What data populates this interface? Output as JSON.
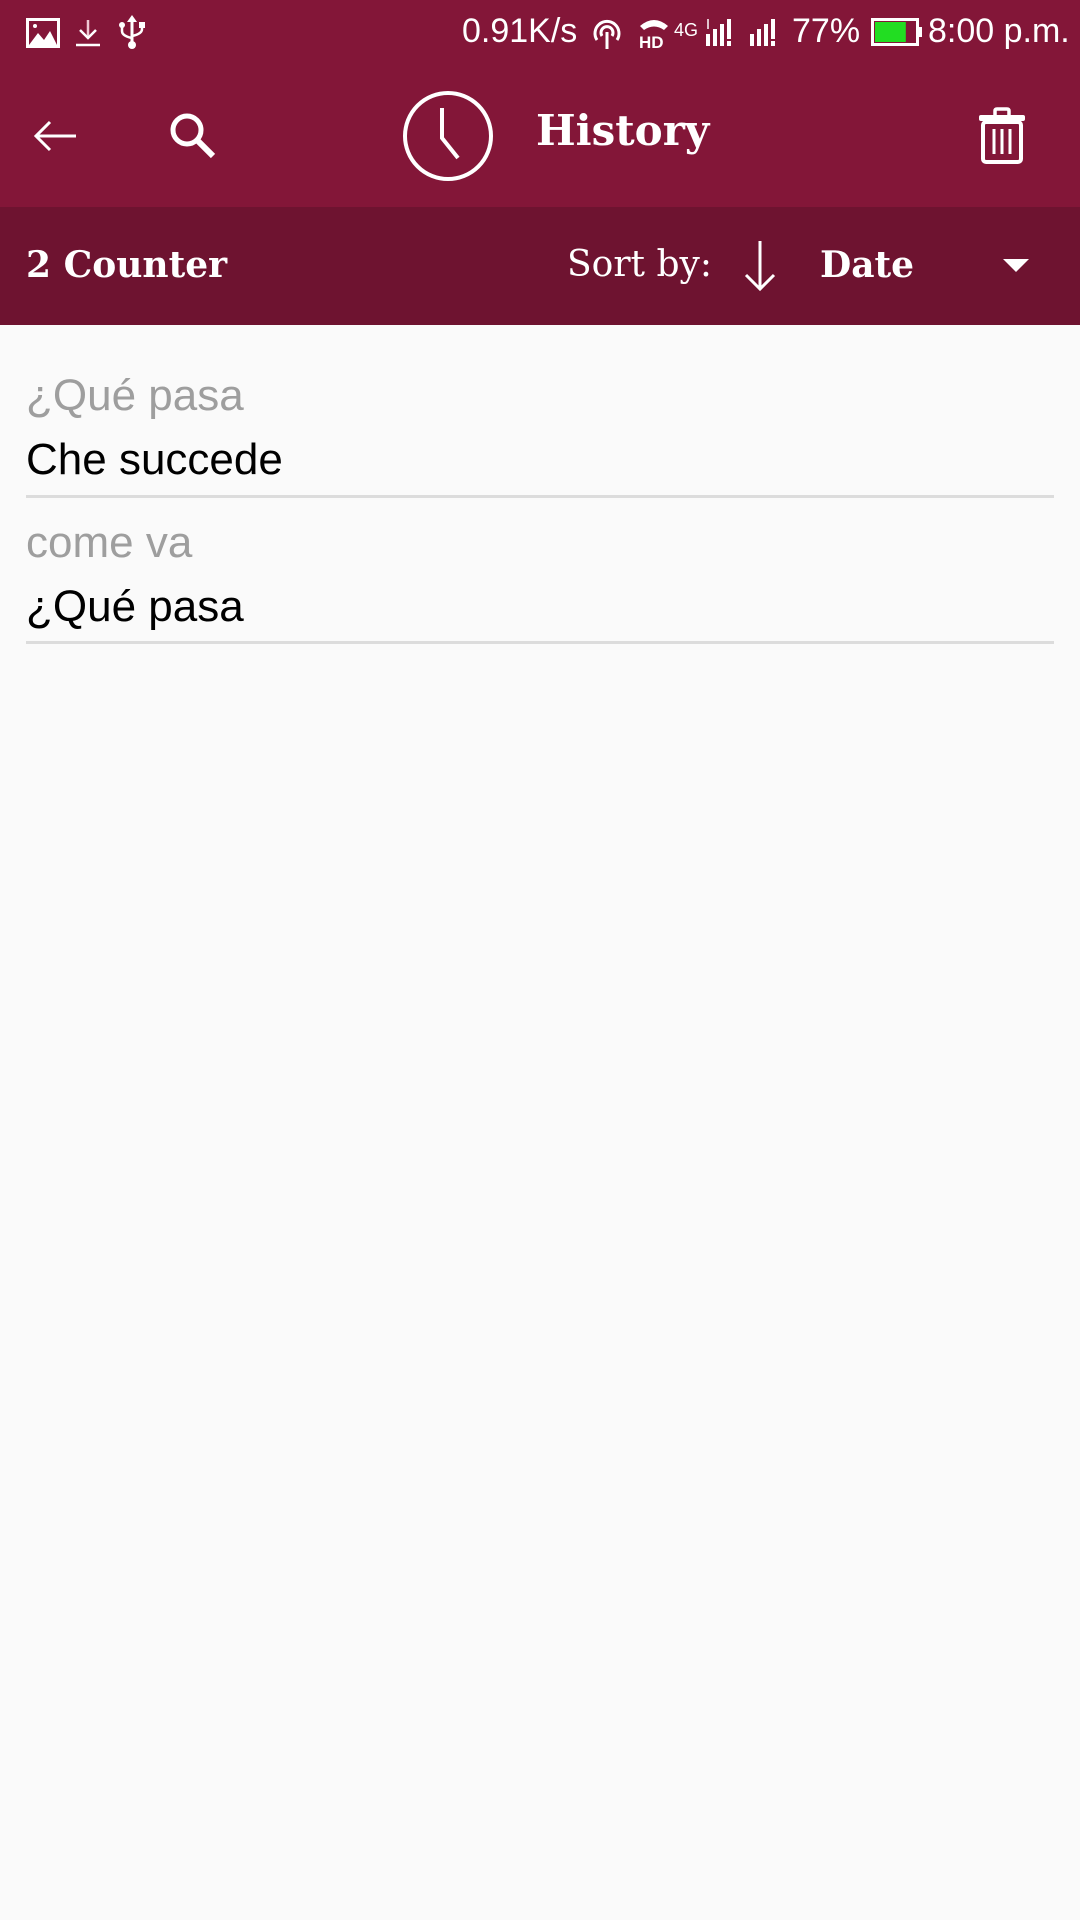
{
  "status_bar": {
    "icons": [
      "image-icon",
      "download-icon",
      "usb-icon",
      "hotspot-icon",
      "hd-call-icon",
      "signal-sim1-icon",
      "signal-sim2-icon",
      "battery-icon"
    ],
    "network_speed": "0.91K/s",
    "network_type": "4G",
    "hd_label": "HD",
    "battery_percent": "77%",
    "battery_level": 0.77,
    "battery_color": "#22dd22",
    "time": "8:00 p.m."
  },
  "app_bar": {
    "title": "History",
    "back_icon": "arrow-left-icon",
    "search_icon": "search-icon",
    "title_icon": "clock-icon",
    "delete_icon": "trash-icon",
    "color": "#831638"
  },
  "sub_bar": {
    "counter": "2 Counter",
    "sort_label": "Sort by:",
    "sort_direction_icon": "arrow-down-icon",
    "sort_value": "Date",
    "color": "#6e1330"
  },
  "history": [
    {
      "source": "¿Qué pasa",
      "translation": "Che succede"
    },
    {
      "source": "come va",
      "translation": "¿Qué pasa"
    }
  ]
}
